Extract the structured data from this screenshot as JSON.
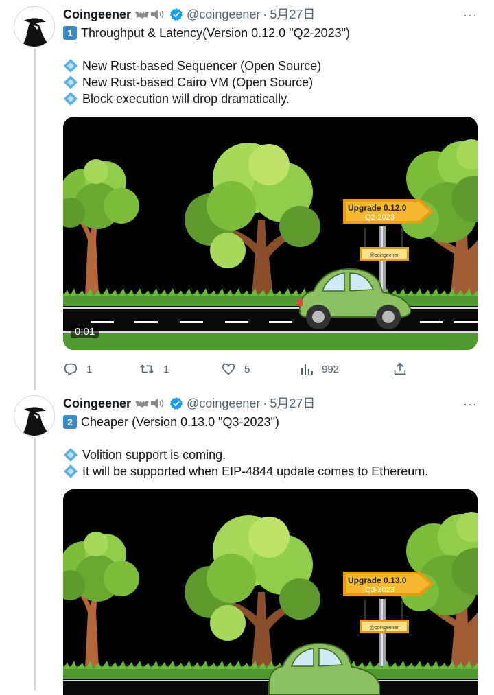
{
  "author": {
    "name": "Coingeener",
    "handle": "@coingeener",
    "date": "5月27日",
    "separator": "·",
    "more": "···"
  },
  "tweets": [
    {
      "number": "1",
      "headline": "Throughput & Latency(Version 0.12.0 \"Q2-2023\")",
      "bullets": [
        "New Rust-based Sequencer (Open Source)",
        "New Rust-based Cairo VM (Open Source)",
        "Block execution will drop dramatically."
      ],
      "video": {
        "timestamp": "0:01",
        "sign_title": "Upgrade 0.12.0",
        "sign_sub": "Q2-2023",
        "plate": "@coingeener"
      },
      "stats": {
        "replies": "1",
        "retweets": "1",
        "likes": "5",
        "views": "992"
      }
    },
    {
      "number": "2",
      "headline": "Cheaper (Version 0.13.0 \"Q3-2023\")",
      "bullets": [
        "Volition support is coming.",
        "It will be supported when EIP-4844 update comes to Ethereum."
      ],
      "video": {
        "sign_title": "Upgrade 0.13.0",
        "sign_sub": "Q3-2023",
        "plate": "@coingeener"
      }
    }
  ],
  "colors": {
    "accent": "#1d9bf0",
    "secondary_text": "#536471",
    "sign_yellow": "#f5b82e",
    "car_green": "#8cc063"
  }
}
